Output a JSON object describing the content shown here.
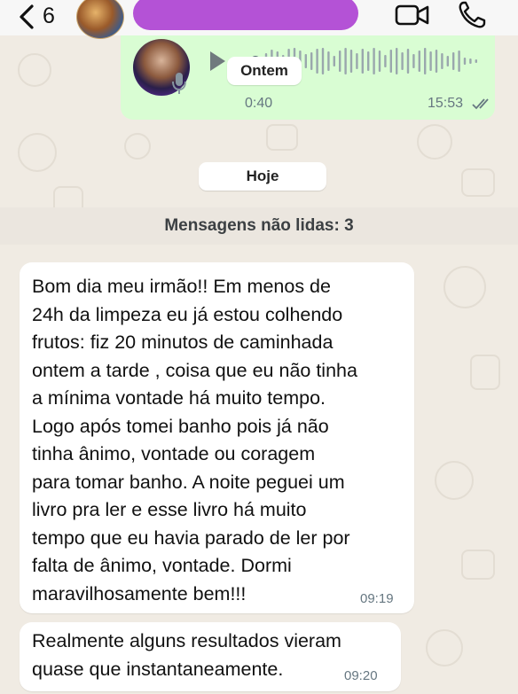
{
  "header": {
    "back_count": "6",
    "contact_name": "",
    "colors": {
      "redaction": "#b452d6",
      "bar": "#f7f7f7"
    },
    "icons": [
      "chevron-left-icon",
      "video-call-icon",
      "phone-icon"
    ]
  },
  "voice_message": {
    "duration": "0:40",
    "time": "15:53",
    "status": "read",
    "date_chip": "Ontem",
    "icons": [
      "play-icon",
      "microphone-icon",
      "double-check-icon"
    ],
    "bubble_color": "#d9fdd3"
  },
  "separator": {
    "day": "Hoje",
    "unread": "Mensagens não lidas: 3"
  },
  "messages": [
    {
      "text": "Bom dia meu irmão!! Em menos de\n24h da limpeza eu já estou colhendo\nfrutos: fiz 20 minutos de caminhada\nontem a tarde , coisa que eu não tinha\na mínima vontade há muito tempo.\nLogo após tomei banho pois já não\ntinha ânimo, vontade ou coragem\npara tomar banho. A noite peguei um\nlivro pra ler e esse livro há muito\ntempo que eu havia parado de ler por\nfalta de ânimo, vontade. Dormi\nmaravilhosamente bem!!!",
      "time": "09:19"
    },
    {
      "text": "Realmente alguns resultados vieram\nquase que instantaneamente.",
      "time": "09:20"
    }
  ],
  "wallpaper_color": "#f0ebe3"
}
